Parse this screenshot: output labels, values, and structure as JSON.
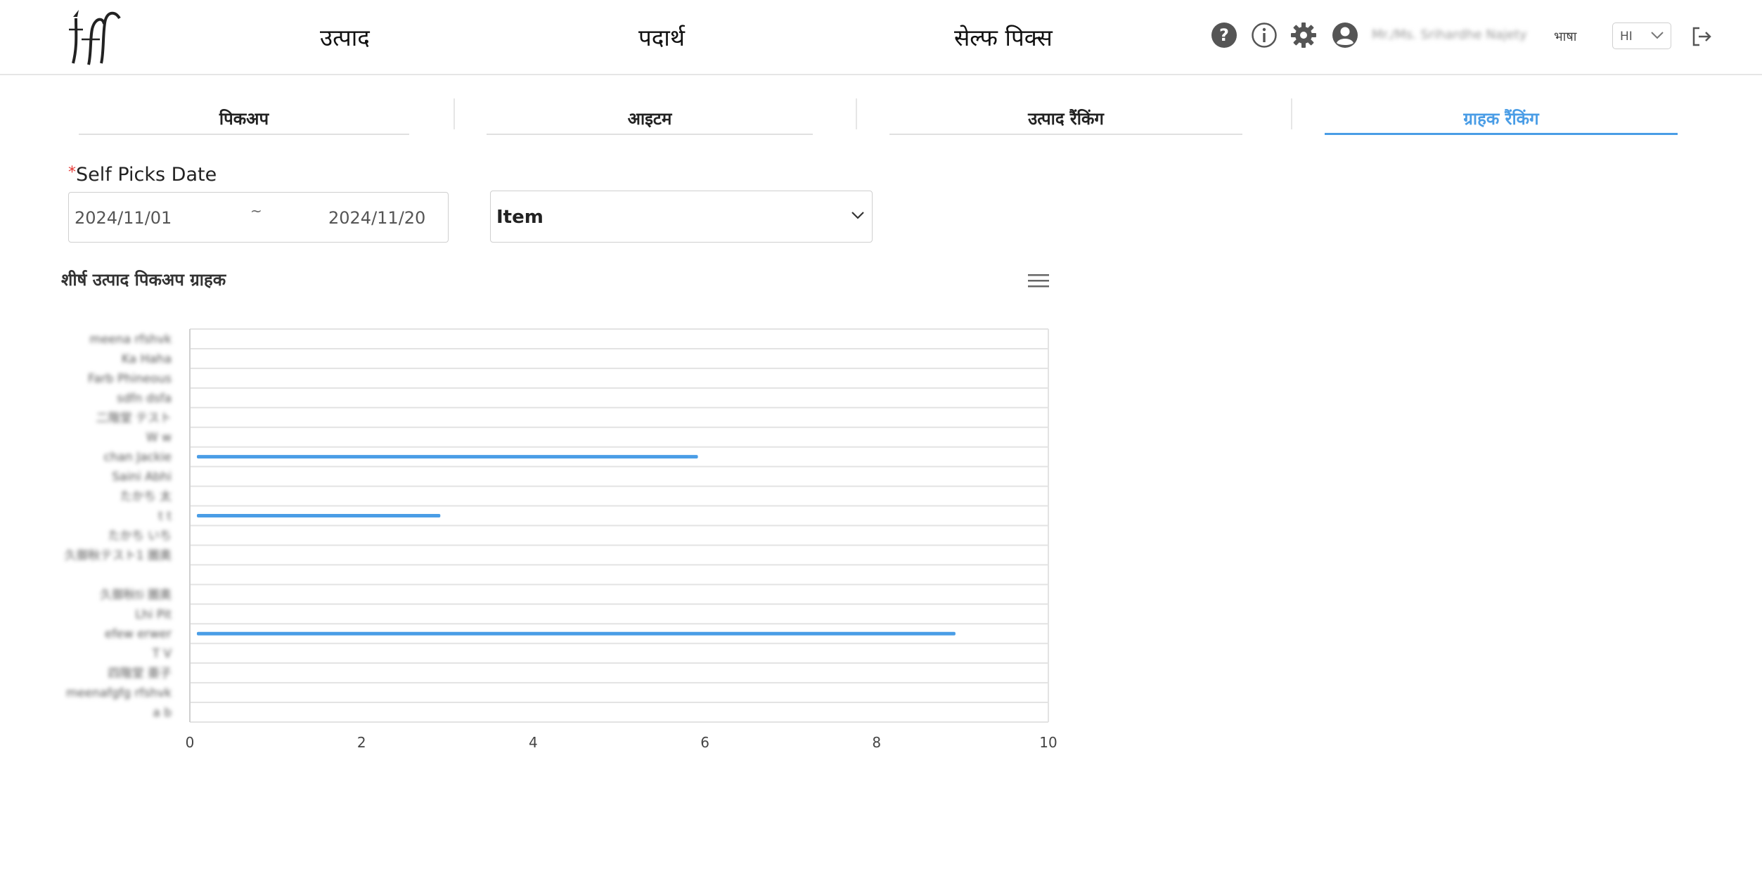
{
  "header": {
    "nav": [
      "उत्पाद",
      "पदार्थ",
      "सेल्फ पिक्स"
    ],
    "user": "Mr./Ms. Srihardhe Najety",
    "language_label": "भाषा",
    "language_value": "HI"
  },
  "tabs": [
    {
      "label": "पिकअप",
      "active": false
    },
    {
      "label": "आइटम",
      "active": false
    },
    {
      "label": "उत्पाद रैंकिंग",
      "active": false
    },
    {
      "label": "ग्राहक रैंकिंग",
      "active": true
    }
  ],
  "filters": {
    "date_label": "Self Picks Date",
    "required_mark": "*",
    "date_start": "2024/11/01",
    "date_separator": "~",
    "date_end": "2024/11/20",
    "select_value": "Item"
  },
  "chart_data": {
    "type": "bar",
    "orientation": "horizontal",
    "title": "शीर्ष उत्पाद पिकअप ग्राहक",
    "categories": [
      "meena rfshvk",
      "Ka Haha",
      "Farb Phineous",
      "sdfn dsfa",
      "二階堂 テスト",
      "W w",
      "chan Jackie",
      "Saini Abhi",
      "たかち 太",
      "t t",
      "たかち いち",
      "久御秋テスト1 圏奥",
      "",
      "久御秋ti 圏奥",
      "Lhi Pit",
      "efew erwer",
      "T V",
      "四階堂 亜子",
      "meenafgfg rfshvk",
      "a b"
    ],
    "values": [
      0,
      0,
      0,
      0,
      0,
      0,
      6,
      0,
      0,
      3,
      0,
      0,
      0,
      0,
      0,
      9,
      0,
      0,
      0,
      0
    ],
    "xlim": [
      0,
      10
    ],
    "xticks": [
      0,
      2,
      4,
      6,
      8,
      10
    ],
    "grid": true,
    "bar_color": "#4a9de6"
  },
  "colors": {
    "accent": "#4a9de6",
    "icon": "#555555"
  }
}
